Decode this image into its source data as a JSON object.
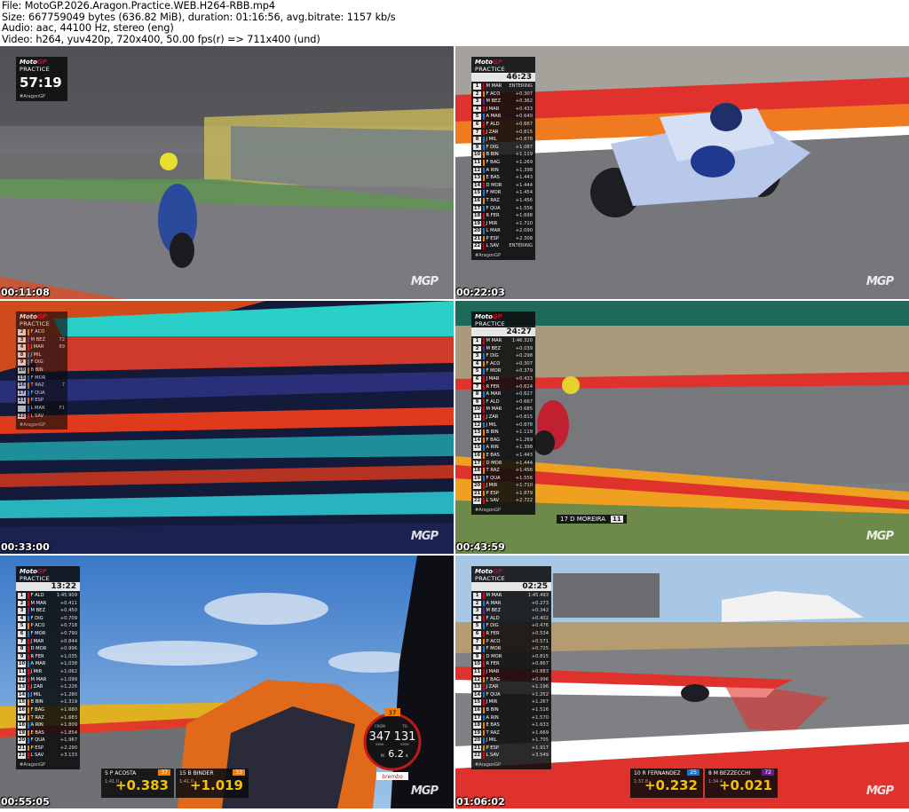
{
  "header": {
    "file_line": "File: MotoGP.2026.Aragon.Practice.WEB.H264-RBB.mp4",
    "size_line": "Size: 667759049 bytes (636.82 MiB), duration: 01:16:56, avg.bitrate: 1157 kb/s",
    "audio_line": "Audio: aac, 44100 Hz, stereo (eng)",
    "video_line": "Video: h264, yuv420p, 720x400, 50.00 fps(r) => 711x400 (und)"
  },
  "watermark": "MGP",
  "thumbs": [
    {
      "timestamp": "00:11:08",
      "overlay": {
        "brand_1": "Moto",
        "brand_2": "GP",
        "session": "PRACTICE",
        "clock": "57:19",
        "tag": "#AragonGP"
      }
    },
    {
      "timestamp": "00:22:03",
      "overlay": {
        "brand_1": "Moto",
        "brand_2": "GP",
        "session": "PRACTICE",
        "clock": "46:23",
        "tag": "#AragonGP",
        "rows": [
          {
            "pos": "1",
            "name": "M MAR",
            "gap": "ENTERING",
            "bar": "#e0001b"
          },
          {
            "pos": "2",
            "name": "F ACO",
            "gap": "+0.307",
            "bar": "#f57c00"
          },
          {
            "pos": "3",
            "name": "M BEZ",
            "gap": "+0.362",
            "bar": "#6a1b9a"
          },
          {
            "pos": "4",
            "name": "J MAR",
            "gap": "+0.433",
            "bar": "#e0001b"
          },
          {
            "pos": "5",
            "name": "A MAR",
            "gap": "+0.640",
            "bar": "#1976d2"
          },
          {
            "pos": "6",
            "name": "F ALD",
            "gap": "+0.667",
            "bar": "#e0001b"
          },
          {
            "pos": "7",
            "name": "J ZAR",
            "gap": "+0.815",
            "bar": "#e0001b"
          },
          {
            "pos": "8",
            "name": "J MIL",
            "gap": "+0.878",
            "bar": "#1976d2"
          },
          {
            "pos": "9",
            "name": "F DIG",
            "gap": "+1.087",
            "bar": "#1976d2"
          },
          {
            "pos": "10",
            "name": "B BIN",
            "gap": "+1.119",
            "bar": "#f57c00"
          },
          {
            "pos": "11",
            "name": "F BAG",
            "gap": "+1.269",
            "bar": "#f57c00"
          },
          {
            "pos": "12",
            "name": "A RIN",
            "gap": "+1.398",
            "bar": "#1976d2"
          },
          {
            "pos": "13",
            "name": "E BAS",
            "gap": "+1.443",
            "bar": "#f57c00"
          },
          {
            "pos": "14",
            "name": "D MOR",
            "gap": "+1.444",
            "bar": "#e0001b"
          },
          {
            "pos": "15",
            "name": "F MOR",
            "gap": "+1.454",
            "bar": "#1976d2"
          },
          {
            "pos": "16",
            "name": "T RAZ",
            "gap": "+1.456",
            "bar": "#f57c00"
          },
          {
            "pos": "17",
            "name": "F QUA",
            "gap": "+1.556",
            "bar": "#1976d2"
          },
          {
            "pos": "18",
            "name": "R FER",
            "gap": "+1.698",
            "bar": "#e0001b"
          },
          {
            "pos": "19",
            "name": "J MIR",
            "gap": "+1.710",
            "bar": "#e0001b"
          },
          {
            "pos": "20",
            "name": "L MAR",
            "gap": "+2.090",
            "bar": "#1976d2"
          },
          {
            "pos": "21",
            "name": "P ESP",
            "gap": "+2.308",
            "bar": "#f57c00"
          },
          {
            "pos": "22",
            "name": "L SAV",
            "gap": "ENTERING",
            "bar": "#e0001b"
          }
        ]
      }
    },
    {
      "timestamp": "00:33:00",
      "overlay": {
        "brand_1": "Moto",
        "brand_2": "GP",
        "session": "PRACTICE",
        "tag": "#AragonGP",
        "rows": [
          {
            "pos": "2",
            "name": "F ACO",
            "gap": "",
            "bar": "#f57c00"
          },
          {
            "pos": "3",
            "name": "M BEZ",
            "gap": "72",
            "bar": "#6a1b9a"
          },
          {
            "pos": "4",
            "name": "J MAR",
            "gap": "89",
            "bar": "#e0001b"
          },
          {
            "pos": "8",
            "name": "J MIL",
            "gap": "",
            "bar": "#1976d2"
          },
          {
            "pos": "9",
            "name": "F DIG",
            "gap": "",
            "bar": "#1976d2"
          },
          {
            "pos": "10",
            "name": "B BIN",
            "gap": "",
            "bar": "#f57c00"
          },
          {
            "pos": "15",
            "name": "F MOR",
            "gap": "",
            "bar": "#1976d2"
          },
          {
            "pos": "16",
            "name": "T RAZ",
            "gap": "7",
            "bar": "#f57c00"
          },
          {
            "pos": "17",
            "name": "F QUA",
            "gap": "",
            "bar": "#1976d2"
          },
          {
            "pos": "21",
            "name": "P ESP",
            "gap": "",
            "bar": "#f57c00"
          },
          {
            "pos": "",
            "name": "L MAR",
            "gap": "F1",
            "bar": "#1976d2"
          },
          {
            "pos": "22",
            "name": "L SAV",
            "gap": "",
            "bar": "#e0001b"
          }
        ]
      }
    },
    {
      "timestamp": "00:43:59",
      "overlay": {
        "brand_1": "Moto",
        "brand_2": "GP",
        "session": "PRACTICE",
        "clock": "24:27",
        "tag": "#AragonGP",
        "rows": [
          {
            "pos": "1",
            "name": "M MAR",
            "gap": "1:46.320",
            "bar": "#e0001b"
          },
          {
            "pos": "2",
            "name": "M BEZ",
            "gap": "+0.039",
            "bar": "#6a1b9a"
          },
          {
            "pos": "3",
            "name": "F DIG",
            "gap": "+0.298",
            "bar": "#1976d2"
          },
          {
            "pos": "4",
            "name": "F ACO",
            "gap": "+0.307",
            "bar": "#f57c00"
          },
          {
            "pos": "5",
            "name": "F MOR",
            "gap": "+0.379",
            "bar": "#1976d2"
          },
          {
            "pos": "6",
            "name": "J MAR",
            "gap": "+0.433",
            "bar": "#e0001b"
          },
          {
            "pos": "7",
            "name": "R FER",
            "gap": "+0.624",
            "bar": "#e0001b"
          },
          {
            "pos": "8",
            "name": "A MAR",
            "gap": "+0.627",
            "bar": "#1976d2"
          },
          {
            "pos": "9",
            "name": "F ALD",
            "gap": "+0.667",
            "bar": "#e0001b"
          },
          {
            "pos": "10",
            "name": "M MAR",
            "gap": "+0.685",
            "bar": "#e0001b"
          },
          {
            "pos": "11",
            "name": "J ZAR",
            "gap": "+0.815",
            "bar": "#e0001b"
          },
          {
            "pos": "12",
            "name": "J MIL",
            "gap": "+0.878",
            "bar": "#1976d2"
          },
          {
            "pos": "13",
            "name": "B BIN",
            "gap": "+1.119",
            "bar": "#f57c00"
          },
          {
            "pos": "14",
            "name": "F BAG",
            "gap": "+1.269",
            "bar": "#f57c00"
          },
          {
            "pos": "15",
            "name": "A RIN",
            "gap": "+1.398",
            "bar": "#1976d2"
          },
          {
            "pos": "16",
            "name": "E BAS",
            "gap": "+1.443",
            "bar": "#f57c00"
          },
          {
            "pos": "17",
            "name": "D MOR",
            "gap": "+1.444",
            "bar": "#e0001b"
          },
          {
            "pos": "18",
            "name": "T RAZ",
            "gap": "+1.456",
            "bar": "#f57c00"
          },
          {
            "pos": "19",
            "name": "F QUA",
            "gap": "+1.556",
            "bar": "#1976d2"
          },
          {
            "pos": "20",
            "name": "J MIR",
            "gap": "+1.710",
            "bar": "#e0001b"
          },
          {
            "pos": "21",
            "name": "P ESP",
            "gap": "+1.879",
            "bar": "#f57c00"
          },
          {
            "pos": "22",
            "name": "L SAV",
            "gap": "+2.722",
            "bar": "#e0001b"
          }
        ],
        "rider_label": {
          "text": "17 D MOREIRA",
          "num": "11"
        }
      }
    },
    {
      "timestamp": "00:55:05",
      "overlay": {
        "brand_1": "Moto",
        "brand_2": "GP",
        "session": "PRACTICE",
        "clock": "13:22",
        "tag": "#AragonGP",
        "rows": [
          {
            "pos": "1",
            "name": "F ALD",
            "gap": "1:45.909",
            "bar": "#e0001b"
          },
          {
            "pos": "2",
            "name": "M MAR",
            "gap": "+0.411",
            "bar": "#e0001b"
          },
          {
            "pos": "3",
            "name": "M BEZ",
            "gap": "+0.450",
            "bar": "#6a1b9a"
          },
          {
            "pos": "4",
            "name": "F DIG",
            "gap": "+0.709",
            "bar": "#1976d2"
          },
          {
            "pos": "5",
            "name": "P ACO",
            "gap": "+0.718",
            "bar": "#f57c00"
          },
          {
            "pos": "6",
            "name": "F MOR",
            "gap": "+0.790",
            "bar": "#1976d2"
          },
          {
            "pos": "7",
            "name": "J MAR",
            "gap": "+0.844",
            "bar": "#e0001b"
          },
          {
            "pos": "8",
            "name": "D MOR",
            "gap": "+0.996",
            "bar": "#e0001b"
          },
          {
            "pos": "9",
            "name": "R FER",
            "gap": "+1.035",
            "bar": "#e0001b"
          },
          {
            "pos": "10",
            "name": "A MAR",
            "gap": "+1.038",
            "bar": "#1976d2"
          },
          {
            "pos": "11",
            "name": "J MIR",
            "gap": "+1.062",
            "bar": "#e0001b"
          },
          {
            "pos": "12",
            "name": "M MAR",
            "gap": "+1.099",
            "bar": "#e0001b"
          },
          {
            "pos": "13",
            "name": "J ZAR",
            "gap": "+1.226",
            "bar": "#e0001b"
          },
          {
            "pos": "14",
            "name": "J MIL",
            "gap": "+1.280",
            "bar": "#1976d2"
          },
          {
            "pos": "15",
            "name": "B BIN",
            "gap": "+1.319",
            "bar": "#f57c00"
          },
          {
            "pos": "16",
            "name": "F BAG",
            "gap": "+1.680",
            "bar": "#f57c00"
          },
          {
            "pos": "17",
            "name": "T RAZ",
            "gap": "+1.683",
            "bar": "#f57c00"
          },
          {
            "pos": "18",
            "name": "A RIN",
            "gap": "+1.809",
            "bar": "#1976d2"
          },
          {
            "pos": "19",
            "name": "E BAS",
            "gap": "+1.854",
            "bar": "#f57c00"
          },
          {
            "pos": "20",
            "name": "F QUA",
            "gap": "+1.967",
            "bar": "#1976d2"
          },
          {
            "pos": "21",
            "name": "P ESP",
            "gap": "+2.290",
            "bar": "#f57c00"
          },
          {
            "pos": "22",
            "name": "L SAV",
            "gap": "+3.133",
            "bar": "#e0001b"
          }
        ],
        "splits": [
          {
            "who": "5 P ACOSTA",
            "sub": "1:41.0",
            "delta": "+0.383",
            "badge": "37",
            "badge_color": "#f57c00"
          },
          {
            "who": "15 B BINDER",
            "sub": "1:41.0",
            "delta": "+1.019",
            "badge": "33",
            "badge_color": "#f57c00"
          }
        ],
        "speedo": {
          "top": "37",
          "from_label": "FROM",
          "to_label": "TO",
          "from": "347",
          "to": "131",
          "unit": "KM/H",
          "time_prefix": "IN",
          "time": "6.2",
          "time_unit": "s",
          "brand": "brembo"
        }
      }
    },
    {
      "timestamp": "01:06:02",
      "overlay": {
        "brand_1": "Moto",
        "brand_2": "GP",
        "session": "PRACTICE",
        "clock": "02:25",
        "tag": "#AragonGP",
        "rows": [
          {
            "pos": "1",
            "name": "M MAR",
            "gap": "1:45.493",
            "bar": "#e0001b"
          },
          {
            "pos": "2",
            "name": "A MAR",
            "gap": "+0.273",
            "bar": "#1976d2"
          },
          {
            "pos": "3",
            "name": "M BEZ",
            "gap": "+0.342",
            "bar": "#6a1b9a"
          },
          {
            "pos": "4",
            "name": "F ALD",
            "gap": "+0.402",
            "bar": "#e0001b"
          },
          {
            "pos": "5",
            "name": "F DIG",
            "gap": "+0.476",
            "bar": "#1976d2"
          },
          {
            "pos": "6",
            "name": "R FER",
            "gap": "+0.534",
            "bar": "#e0001b"
          },
          {
            "pos": "7",
            "name": "P ACO",
            "gap": "+0.571",
            "bar": "#f57c00"
          },
          {
            "pos": "8",
            "name": "F MOR",
            "gap": "+0.725",
            "bar": "#1976d2"
          },
          {
            "pos": "9",
            "name": "D MOR",
            "gap": "+0.815",
            "bar": "#e0001b"
          },
          {
            "pos": "10",
            "name": "R FER",
            "gap": "+0.867",
            "bar": "#e0001b"
          },
          {
            "pos": "11",
            "name": "J MAR",
            "gap": "+0.883",
            "bar": "#e0001b"
          },
          {
            "pos": "12",
            "name": "F BAG",
            "gap": "+0.996",
            "bar": "#f57c00"
          },
          {
            "pos": "13",
            "name": "J ZAR",
            "gap": "+1.196",
            "bar": "#e0001b"
          },
          {
            "pos": "14",
            "name": "F QUA",
            "gap": "+1.252",
            "bar": "#1976d2"
          },
          {
            "pos": "15",
            "name": "J MIR",
            "gap": "+1.267",
            "bar": "#e0001b"
          },
          {
            "pos": "16",
            "name": "B BIN",
            "gap": "+1.516",
            "bar": "#f57c00"
          },
          {
            "pos": "17",
            "name": "A RIN",
            "gap": "+1.570",
            "bar": "#1976d2"
          },
          {
            "pos": "18",
            "name": "E BAS",
            "gap": "+1.633",
            "bar": "#f57c00"
          },
          {
            "pos": "19",
            "name": "T RAZ",
            "gap": "+1.669",
            "bar": "#f57c00"
          },
          {
            "pos": "20",
            "name": "J MIL",
            "gap": "+1.705",
            "bar": "#1976d2"
          },
          {
            "pos": "21",
            "name": "P ESP",
            "gap": "+1.917",
            "bar": "#f57c00"
          },
          {
            "pos": "22",
            "name": "L SAV",
            "gap": "+3.549",
            "bar": "#e0001b"
          }
        ],
        "splits": [
          {
            "who": "10 R FERNANDEZ",
            "sub": "1:37.8",
            "delta": "+0.232",
            "badge": "25",
            "badge_color": "#1976d2"
          },
          {
            "who": "8 M BEZZECCHI",
            "sub": "1:34.4",
            "delta": "+0.021",
            "badge": "72",
            "badge_color": "#6a1b9a"
          }
        ]
      }
    }
  ]
}
